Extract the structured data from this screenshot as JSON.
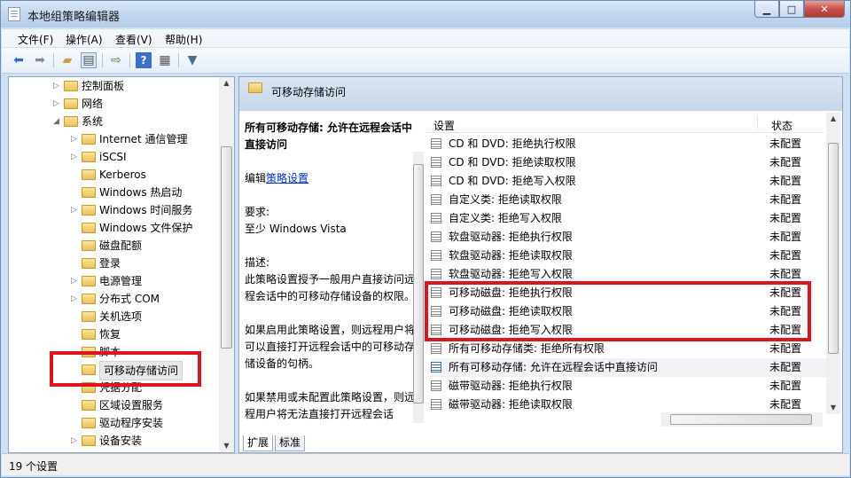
{
  "window": {
    "title": "本地组策略编辑器",
    "minimize": "▁",
    "maximize": "□",
    "close": "✕"
  },
  "menu": [
    "文件(F)",
    "操作(A)",
    "查看(V)",
    "帮助(H)"
  ],
  "toolbar_icons": [
    "back-arrow-icon",
    "forward-arrow-icon",
    "up-folder-icon",
    "show-hide-tree-icon",
    "export-list-icon",
    "help-icon",
    "properties-icon",
    "filter-icon"
  ],
  "tree": {
    "items": [
      {
        "label": "控制面板",
        "arrow": "▷"
      },
      {
        "label": "网络",
        "arrow": "▷"
      },
      {
        "label": "系统",
        "arrow": "◢"
      },
      {
        "label": "Internet 通信管理",
        "arrow": "▷"
      },
      {
        "label": "iSCSI",
        "arrow": "▷"
      },
      {
        "label": "Kerberos",
        "arrow": ""
      },
      {
        "label": "Windows 热启动",
        "arrow": ""
      },
      {
        "label": "Windows 时间服务",
        "arrow": "▷"
      },
      {
        "label": "Windows 文件保护",
        "arrow": ""
      },
      {
        "label": "磁盘配额",
        "arrow": ""
      },
      {
        "label": "登录",
        "arrow": ""
      },
      {
        "label": "电源管理",
        "arrow": "▷"
      },
      {
        "label": "分布式 COM",
        "arrow": "▷"
      },
      {
        "label": "关机选项",
        "arrow": ""
      },
      {
        "label": "恢复",
        "arrow": ""
      },
      {
        "label": "脚本",
        "arrow": ""
      },
      {
        "label": "可移动存储访问",
        "arrow": ""
      },
      {
        "label": "凭据分配",
        "arrow": ""
      },
      {
        "label": "区域设置服务",
        "arrow": ""
      },
      {
        "label": "驱动程序安装",
        "arrow": ""
      },
      {
        "label": "设备安装",
        "arrow": "▷"
      }
    ]
  },
  "right": {
    "header_title": "可移动存储访问",
    "desc_title": "所有可移动存储: 允许在远程会话中直接访问",
    "edit_prefix": "编辑",
    "edit_link": "策略设置",
    "req_label": "要求:",
    "req_value": "至少 Windows Vista",
    "desc_label": "描述:",
    "desc_p1": "此策略设置授予一般用户直接访问远程会话中的可移动存储设备的权限。",
    "desc_p2": "如果启用此策略设置，则远程用户将可以直接打开远程会话中的可移动存储设备的句柄。",
    "desc_p3": "如果禁用或未配置此策略设置，则远程用户将无法直接打开远程会话",
    "col_setting": "设置",
    "col_state": "状态",
    "rows": [
      {
        "name": "CD 和 DVD: 拒绝执行权限",
        "state": "未配置"
      },
      {
        "name": "CD 和 DVD: 拒绝读取权限",
        "state": "未配置"
      },
      {
        "name": "CD 和 DVD: 拒绝写入权限",
        "state": "未配置"
      },
      {
        "name": "自定义类: 拒绝读取权限",
        "state": "未配置"
      },
      {
        "name": "自定义类: 拒绝写入权限",
        "state": "未配置"
      },
      {
        "name": "软盘驱动器: 拒绝执行权限",
        "state": "未配置"
      },
      {
        "name": "软盘驱动器: 拒绝读取权限",
        "state": "未配置"
      },
      {
        "name": "软盘驱动器: 拒绝写入权限",
        "state": "未配置"
      },
      {
        "name": "可移动磁盘: 拒绝执行权限",
        "state": "未配置"
      },
      {
        "name": "可移动磁盘: 拒绝读取权限",
        "state": "未配置"
      },
      {
        "name": "可移动磁盘: 拒绝写入权限",
        "state": "未配置"
      },
      {
        "name": "所有可移动存储类: 拒绝所有权限",
        "state": "未配置"
      },
      {
        "name": "所有可移动存储: 允许在远程会话中直接访问",
        "state": "未配置"
      },
      {
        "name": "磁带驱动器: 拒绝执行权限",
        "state": "未配置"
      },
      {
        "name": "磁带驱动器: 拒绝读取权限",
        "state": "未配置"
      }
    ],
    "tab_extended": "扩展",
    "tab_standard": "标准"
  },
  "status": "19 个设置",
  "colors": {
    "highlight_box": "#e0141e",
    "link": "#0033cc"
  }
}
